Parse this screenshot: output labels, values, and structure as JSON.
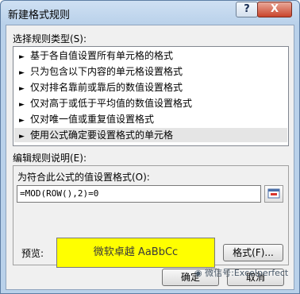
{
  "dialog": {
    "title": "新建格式规则",
    "help_label": "?",
    "close_label": "X"
  },
  "rule_type": {
    "label": "选择规则类型(S):",
    "items": [
      "基于各自值设置所有单元格的格式",
      "只为包含以下内容的单元格设置格式",
      "仅对排名靠前或靠后的数值设置格式",
      "仅对高于或低于平均值的数值设置格式",
      "仅对唯一值或重复值设置格式",
      "使用公式确定要设置格式的单元格"
    ],
    "selected_index": 5
  },
  "rule_description": {
    "label": "编辑规则说明(E):",
    "formula_label": "为符合此公式的值设置格式(O):",
    "formula_value": "=MOD(ROW(),2)=0",
    "preview_label": "预览:",
    "preview_text": "微软卓越  AaBbCc",
    "preview_bg": "#ffff00",
    "format_button": "格式(F)..."
  },
  "footer": {
    "ok_button": "确定",
    "cancel_button": "取消"
  },
  "watermark": {
    "text": "微信号:Excelperfect"
  }
}
